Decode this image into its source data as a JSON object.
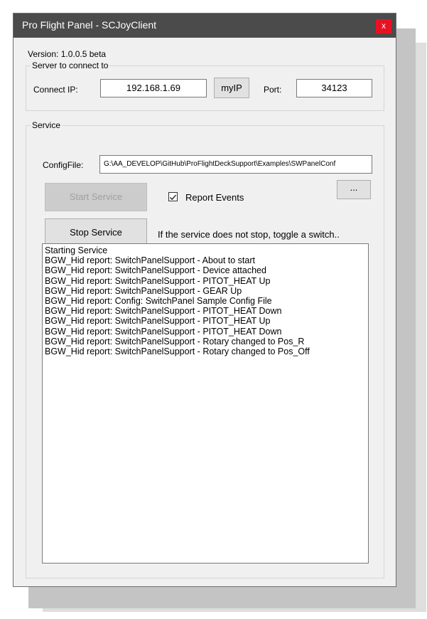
{
  "window": {
    "title": "Pro Flight Panel - SCJoyClient",
    "close_label": "x"
  },
  "version": "Version: 1.0.0.5 beta",
  "server": {
    "group_label": "Server to connect to",
    "ip_label": "Connect IP:",
    "ip_value": "192.168.1.69",
    "myip_label": "myIP",
    "port_label": "Port:",
    "port_value": "34123"
  },
  "service": {
    "group_label": "Service",
    "config_label": "ConfigFile:",
    "config_value": "G:\\AA_DEVELOP\\GitHub\\ProFlightDeckSupport\\Examples\\SWPanelConf",
    "browse_label": "...",
    "start_label": "Start Service",
    "report_events_label": "Report Events",
    "report_events_checked": true,
    "stop_label": "Stop Service",
    "stop_hint": "If the service does not stop, toggle a switch.."
  },
  "log": [
    "Starting Service",
    "BGW_Hid report: SwitchPanelSupport - About to start",
    "BGW_Hid report: SwitchPanelSupport - Device attached",
    "BGW_Hid report: SwitchPanelSupport - PITOT_HEAT Up",
    "BGW_Hid report: SwitchPanelSupport - GEAR Up",
    "BGW_Hid report:  Config: SwitchPanel Sample Config File",
    "BGW_Hid report: SwitchPanelSupport - PITOT_HEAT Down",
    "BGW_Hid report: SwitchPanelSupport - PITOT_HEAT Up",
    "BGW_Hid report: SwitchPanelSupport - PITOT_HEAT Down",
    "BGW_Hid report: SwitchPanelSupport - Rotary changed to Pos_R",
    "BGW_Hid report: SwitchPanelSupport - Rotary changed to Pos_Off"
  ],
  "colors": {
    "titlebar": "#4b4b4b",
    "close": "#e81123",
    "window_bg": "#f0f0f0"
  }
}
